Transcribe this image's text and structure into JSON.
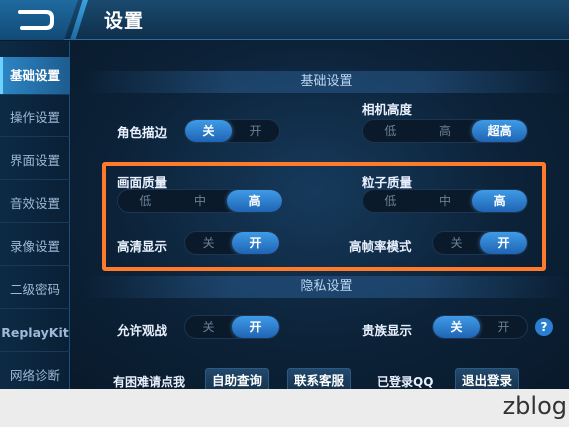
{
  "header": {
    "title": "设置"
  },
  "sidebar": {
    "items": [
      {
        "label": "基础设置",
        "active": true
      },
      {
        "label": "操作设置"
      },
      {
        "label": "界面设置"
      },
      {
        "label": "音效设置"
      },
      {
        "label": "录像设置"
      },
      {
        "label": "二级密码"
      },
      {
        "label": "ReplayKit"
      },
      {
        "label": "网络诊断"
      }
    ]
  },
  "basic": {
    "section_title": "基础设置",
    "outline": {
      "label": "角色描边",
      "options": [
        "关",
        "开"
      ],
      "selected": "关"
    },
    "camera": {
      "label": "相机高度",
      "options": [
        "低",
        "高",
        "超高"
      ],
      "selected": "超高"
    },
    "quality": {
      "label": "画面质量",
      "options": [
        "低",
        "中",
        "高"
      ],
      "selected": "高"
    },
    "particle": {
      "label": "粒子质量",
      "options": [
        "低",
        "中",
        "高"
      ],
      "selected": "高"
    },
    "hd": {
      "label": "高清显示",
      "options": [
        "关",
        "开"
      ],
      "selected": "开"
    },
    "hfr": {
      "label": "高帧率模式",
      "options": [
        "关",
        "开"
      ],
      "selected": "开"
    }
  },
  "privacy": {
    "section_title": "隐私设置",
    "watch": {
      "label": "允许观战",
      "options": [
        "关",
        "开"
      ],
      "selected": "开"
    },
    "noble": {
      "label": "贵族显示",
      "options": [
        "关",
        "开"
      ],
      "selected": "关"
    },
    "help_glyph": "?"
  },
  "footer": {
    "trouble_text": "有困难请点我",
    "self_query": "自助查询",
    "contact": "联系客服",
    "logged_in": "已登录QQ",
    "logout": "退出登录"
  },
  "watermark": "zblog"
}
